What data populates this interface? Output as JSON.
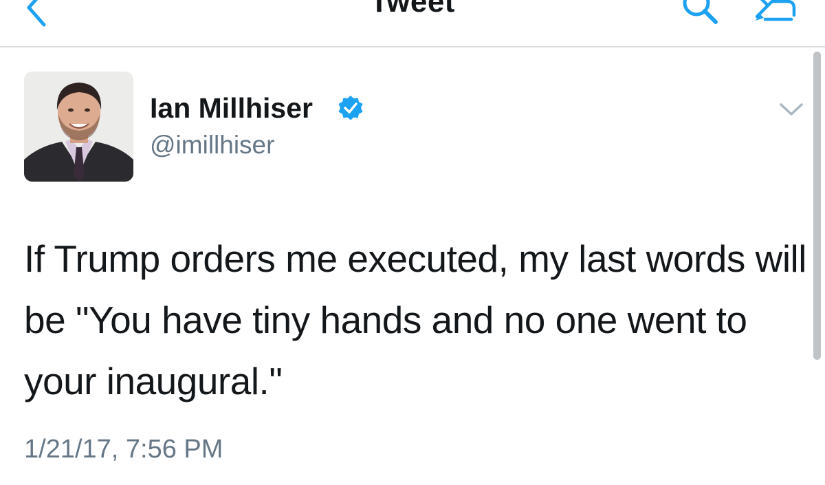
{
  "navbar": {
    "title": "Tweet",
    "back_icon": "chevron-left-icon",
    "search_icon": "search-icon",
    "compose_icon": "compose-icon"
  },
  "tweet": {
    "display_name": "Ian Millhiser",
    "handle": "@imillhiser",
    "verified": true,
    "text": "If Trump orders me executed, my last words will be \"You have tiny hands and no one went to your inaugural.\"",
    "timestamp": "1/21/17, 7:56 PM"
  },
  "colors": {
    "accent": "#1da1f2",
    "text": "#14171a",
    "secondary_text": "#657786",
    "divider": "#d9dde0"
  }
}
